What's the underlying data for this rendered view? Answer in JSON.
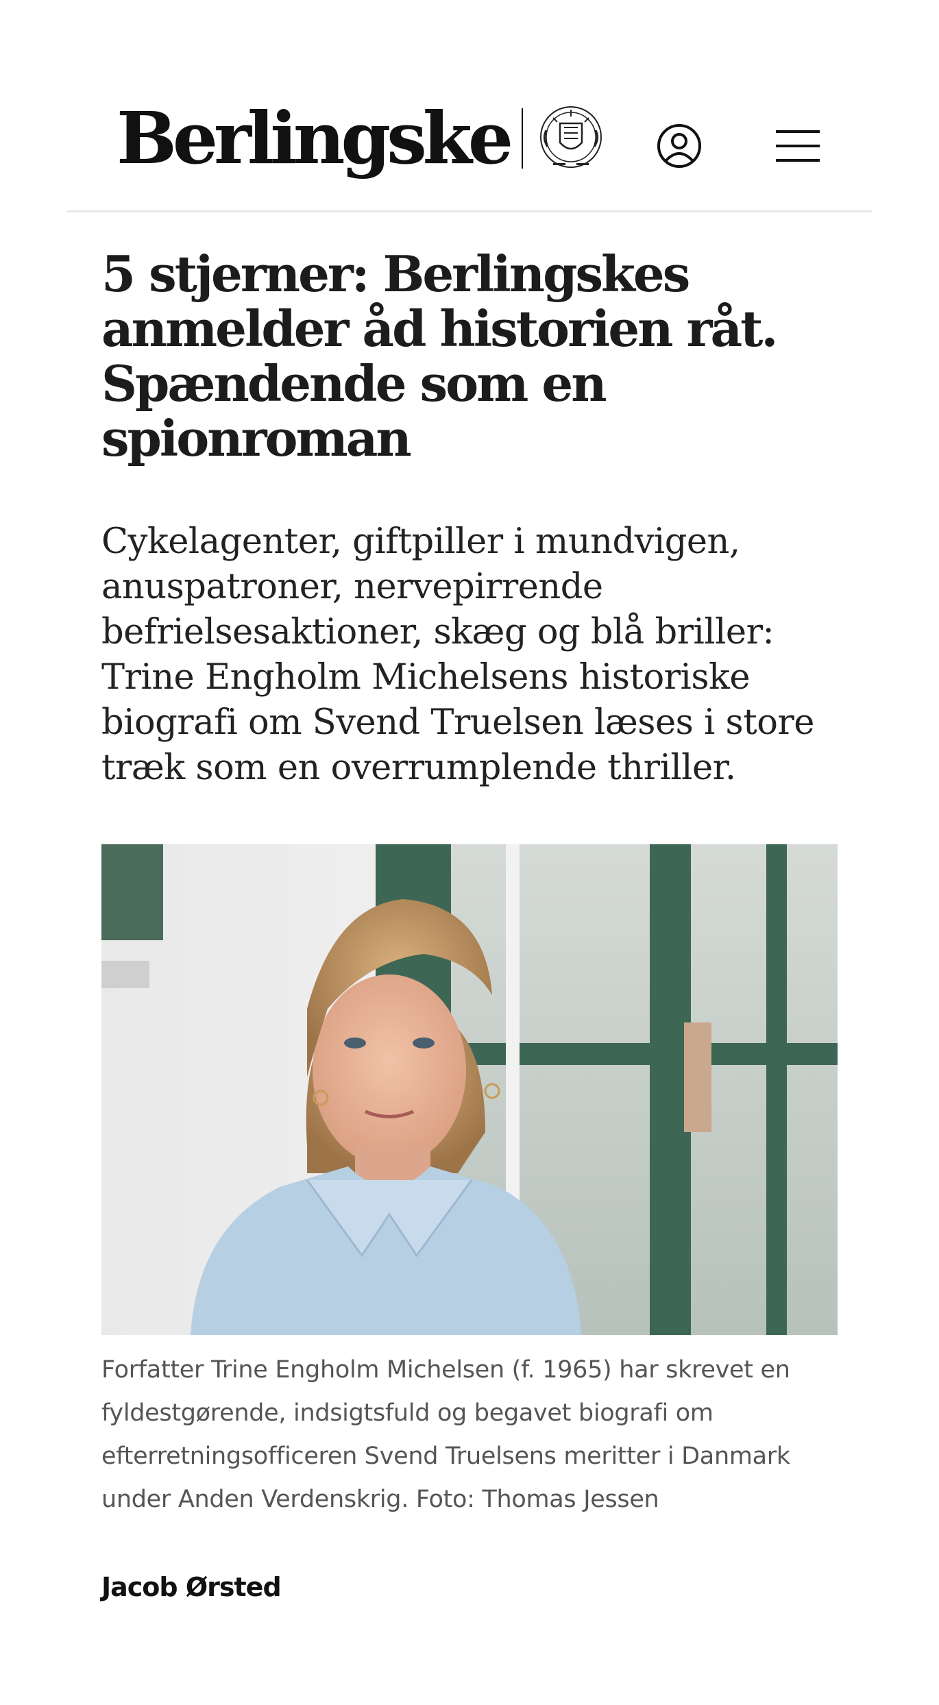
{
  "header": {
    "brand_name": "Berlingske",
    "crest_icon": "crest-logo-icon",
    "account_icon": "user-icon",
    "menu_icon": "hamburger-menu-icon"
  },
  "article": {
    "headline": "5 stjerner: Berlingskes anmelder åd historien råt. Spændende som en spionroman",
    "lead": "Cykelagenter, giftpiller i mundvigen, anuspatroner, nervepirrende befrielsesaktioner, skæg og blå briller: Trine Engholm Michelsens historiske biografi om Svend Truelsen læses i store træk som en overrumplende thriller.",
    "image_caption": "Forfatter Trine Engholm Michelsen (f. 1965) har skrevet en fyldestgørende, indsigtsfuld og begavet biografi om efterretningsofficeren Svend Truelsens meritter i Danmark under Anden Verdenskrig. Foto: Thomas Jessen",
    "byline": "Jacob Ørsted"
  },
  "colors": {
    "text": "#1c1c1c",
    "caption": "#555555",
    "divider": "#e8e8e8",
    "frame_green": "#3d6654",
    "sweater_blue": "#b7cfe3"
  }
}
